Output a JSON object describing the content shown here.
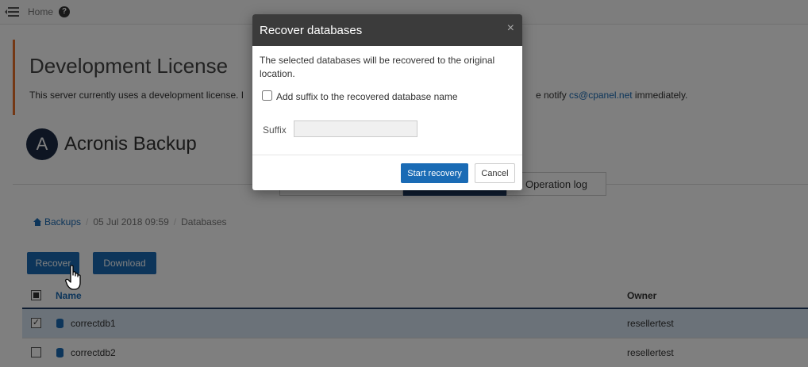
{
  "topbar": {
    "home_label": "Home",
    "help_icon": "help-icon"
  },
  "notice": {
    "title": "Development License",
    "text": "This server currently uses a development license. I",
    "text_end_prefix": "e notify ",
    "email": "cs@cpanel.net",
    "text_end_suffix": " immediately."
  },
  "product": {
    "logo_letter": "A",
    "title": "Acronis Backup"
  },
  "tabs": [
    {
      "label": ""
    },
    {
      "label": ""
    },
    {
      "label": "Operation log"
    }
  ],
  "breadcrumb": {
    "items": [
      {
        "label": "Backups"
      },
      {
        "label": "05 Jul 2018 09:59"
      },
      {
        "label": "Databases"
      }
    ]
  },
  "toolbar": {
    "recover_label": "Recover",
    "download_label": "Download"
  },
  "table": {
    "columns": {
      "name": "Name",
      "owner": "Owner"
    },
    "rows": [
      {
        "name": "correctdb1",
        "owner": "resellertest",
        "checked": true
      },
      {
        "name": "correctdb2",
        "owner": "resellertest",
        "checked": false
      }
    ]
  },
  "modal": {
    "title": "Recover databases",
    "close_glyph": "×",
    "description": "The selected databases will be recovered to the original location.",
    "checkbox_label": "Add suffix to the recovered database name",
    "suffix_label": "Suffix",
    "suffix_value": "",
    "start_label": "Start recovery",
    "cancel_label": "Cancel"
  },
  "colors": {
    "primary": "#1a6bb5",
    "accent": "#e8702a",
    "dark": "#1f3b63",
    "modal_header": "#3b3b3b"
  }
}
